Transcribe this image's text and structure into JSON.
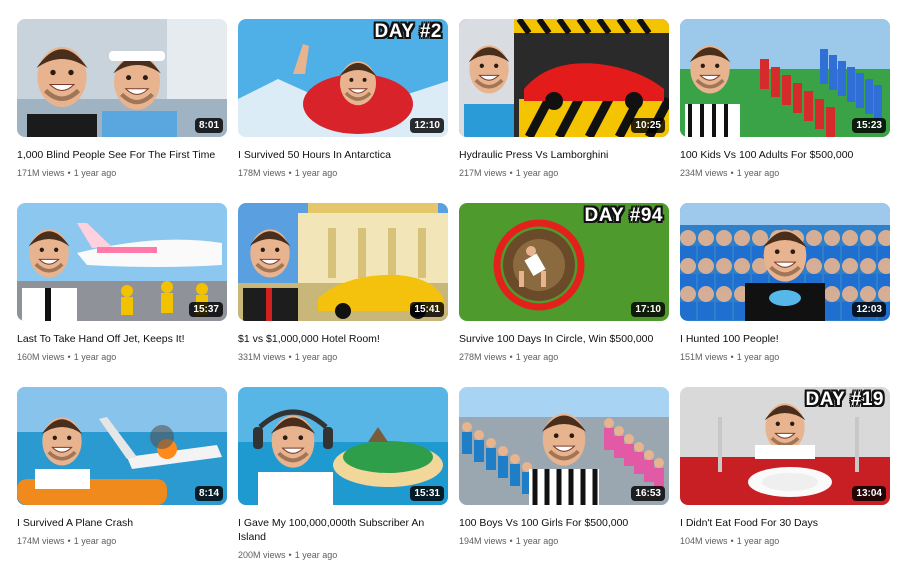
{
  "videos": [
    {
      "title": "1,000 Blind People See For The First Time",
      "duration": "8:01",
      "views": "171M views",
      "age": "1 year ago",
      "day": "",
      "thumb_icon": "boy-with-headband-thumbnail",
      "bg": "#c9d3dc",
      "accent": "#5aa7e0"
    },
    {
      "title": "I Survived 50 Hours In Antarctica",
      "duration": "12:10",
      "views": "178M views",
      "age": "1 year ago",
      "day": "DAY #2",
      "thumb_icon": "antarctica-snow-thumbnail",
      "bg": "#4fb0e8",
      "accent": "#d8232a"
    },
    {
      "title": "Hydraulic Press Vs Lamborghini",
      "duration": "10:25",
      "views": "217M views",
      "age": "1 year ago",
      "day": "",
      "thumb_icon": "red-lamborghini-press-thumbnail",
      "bg": "#2a2a2a",
      "accent": "#e31b1b"
    },
    {
      "title": "100 Kids Vs 100 Adults For $500,000",
      "duration": "15:23",
      "views": "234M views",
      "age": "1 year ago",
      "day": "",
      "thumb_icon": "kids-vs-adults-thumbnail",
      "bg": "#3aa347",
      "accent": "#d62b2b"
    },
    {
      "title": "Last To Take Hand Off Jet, Keeps It!",
      "duration": "15:37",
      "views": "160M views",
      "age": "1 year ago",
      "day": "",
      "thumb_icon": "private-jet-thumbnail",
      "bg": "#8cc7ef",
      "accent": "#f2c200"
    },
    {
      "title": "$1 vs $1,000,000 Hotel Room!",
      "duration": "15:41",
      "views": "331M views",
      "age": "1 year ago",
      "day": "",
      "thumb_icon": "luxury-hotel-thumbnail",
      "bg": "#5aa0e0",
      "accent": "#f4c20d"
    },
    {
      "title": "Survive 100 Days In Circle, Win $500,000",
      "duration": "17:10",
      "views": "278M views",
      "age": "1 year ago",
      "day": "DAY #94",
      "thumb_icon": "circle-in-grass-thumbnail",
      "bg": "#4f9a2c",
      "accent": "#e3201c"
    },
    {
      "title": "I Hunted 100 People!",
      "duration": "12:03",
      "views": "151M views",
      "age": "1 year ago",
      "day": "",
      "thumb_icon": "blue-crowd-thumbnail",
      "bg": "#2f7fc9",
      "accent": "#111111"
    },
    {
      "title": "I Survived A Plane Crash",
      "duration": "8:14",
      "views": "174M views",
      "age": "1 year ago",
      "day": "",
      "thumb_icon": "plane-crash-ocean-thumbnail",
      "bg": "#3aa0d6",
      "accent": "#f08a1c"
    },
    {
      "title": "I Gave My 100,000,000th Subscriber An Island",
      "duration": "15:31",
      "views": "200M views",
      "age": "1 year ago",
      "day": "",
      "thumb_icon": "island-helicopter-thumbnail",
      "bg": "#58b6e6",
      "accent": "#2e9e4a"
    },
    {
      "title": "100 Boys Vs 100 Girls For $500,000",
      "duration": "16:53",
      "views": "194M views",
      "age": "1 year ago",
      "day": "",
      "thumb_icon": "boys-vs-girls-thumbnail",
      "bg": "#7ab8e8",
      "accent": "#e25aa5"
    },
    {
      "title": "I Didn't Eat Food For 30 Days",
      "duration": "13:04",
      "views": "104M views",
      "age": "1 year ago",
      "day": "DAY #19",
      "thumb_icon": "empty-plate-thumbnail",
      "bg": "#d9d9d9",
      "accent": "#c81f24"
    }
  ],
  "separator": "•"
}
